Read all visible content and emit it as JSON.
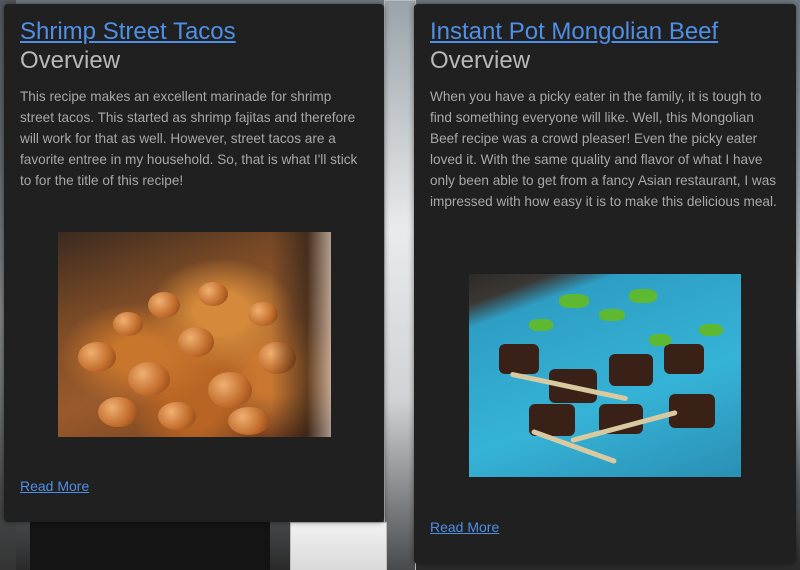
{
  "cards": [
    {
      "title": "Shrimp Street Tacos",
      "subtitle": "Overview",
      "description": "This recipe makes an excellent marinade for shrimp street tacos. This started as shrimp fajitas and therefore will work for that as well. However, street tacos are a favorite entree in my household. So, that is what I'll stick to for the title of this recipe!",
      "read_more": "Read More"
    },
    {
      "title": "Instant Pot Mongolian Beef",
      "subtitle": "Overview",
      "description": "When you have a picky eater in the family, it is tough to find something everyone will like. Well, this Mongolian Beef recipe was a crowd pleaser! Even the picky eater loved it. With the same quality and flavor of what I have only been able to get from a fancy Asian restaurant, I was impressed with how easy it is to make this delicious meal.",
      "read_more": "Read More"
    }
  ],
  "colors": {
    "card_bg": "#202020",
    "link": "#4f8fe6",
    "text": "#a8a8a8",
    "subtitle": "#b8b8b8"
  }
}
